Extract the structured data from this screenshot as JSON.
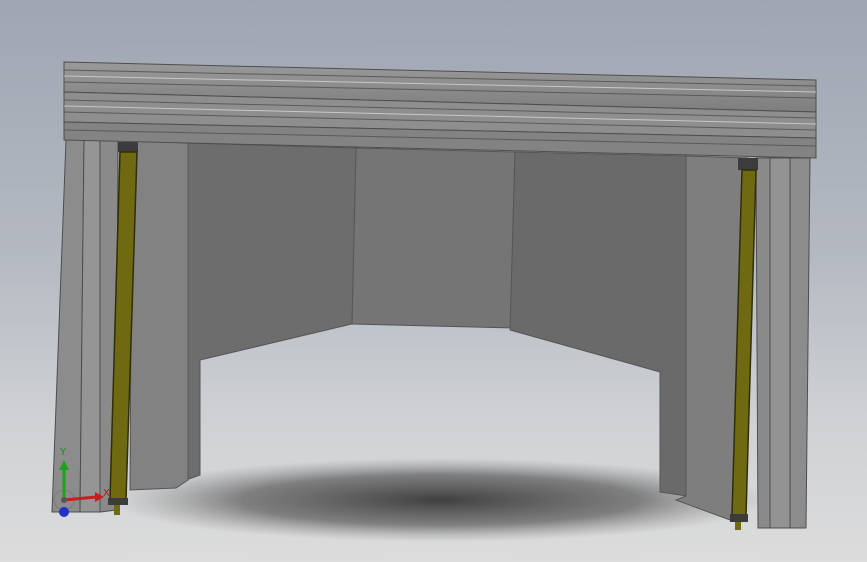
{
  "viewport": {
    "type": "cad-3d-view",
    "background_top": "#9fa6b2",
    "background_bottom": "#dcdcdc"
  },
  "model": {
    "frame_color": "#8a8a8a",
    "panel_color": "#6c6c6c",
    "sensor_color": "#6f6a12",
    "shadow_color": "#3d3d3d"
  },
  "triad": {
    "x_label": "X",
    "y_label": "Y",
    "x_color": "#c81e1e",
    "y_color": "#20a020",
    "z_color": "#2030c8"
  }
}
